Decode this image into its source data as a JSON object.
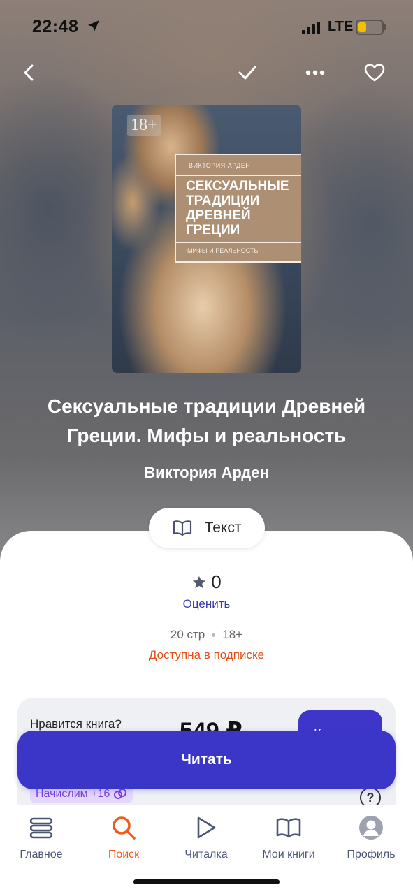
{
  "status_bar": {
    "time": "22:48",
    "network": "LTE",
    "location_icon": "location-arrow-icon",
    "battery_color": "#f2c200"
  },
  "top_nav": {
    "back_icon": "chevron-left-icon",
    "check_icon": "checkmark-icon",
    "more_icon": "more-dots-icon",
    "favorite_icon": "heart-outline-icon"
  },
  "cover": {
    "age_badge": "18+",
    "author": "ВИКТОРИЯ АРДЕН",
    "title": "СЕКСУАЛЬНЫЕ\nТРАДИЦИИ\nДРЕВНЕЙ\nГРЕЦИИ",
    "subtitle": "МИФЫ И РЕАЛЬНОСТЬ"
  },
  "book": {
    "title": "Сексуальные традиции Древней Греции. Мифы и реальность",
    "author": "Виктория Арден",
    "format_label": "Текст",
    "format_icon": "open-book-icon",
    "rating_value": "0",
    "rate_link": "Оценить",
    "pages": "20 стр",
    "age_rating": "18+",
    "subscription_note": "Доступна в подписке"
  },
  "promo": {
    "question": "Нравится книга?",
    "price": "549 ₽",
    "buy_label": "К",
    "bonus": "Начислим +16",
    "help": "?"
  },
  "primary_action": {
    "label": "Читать"
  },
  "tabbar": {
    "items": [
      {
        "label": "Главное",
        "icon": "stack-icon",
        "active": false
      },
      {
        "label": "Поиск",
        "icon": "search-icon",
        "active": true
      },
      {
        "label": "Читалка",
        "icon": "play-icon",
        "active": false
      },
      {
        "label": "Мои книги",
        "icon": "open-book-icon",
        "active": false
      },
      {
        "label": "Профиль",
        "icon": "avatar-icon",
        "active": false
      }
    ]
  },
  "colors": {
    "accent": "#3c36c8",
    "active_tab": "#f05a1a",
    "subscription": "#e0501a",
    "link": "#3838b0"
  }
}
